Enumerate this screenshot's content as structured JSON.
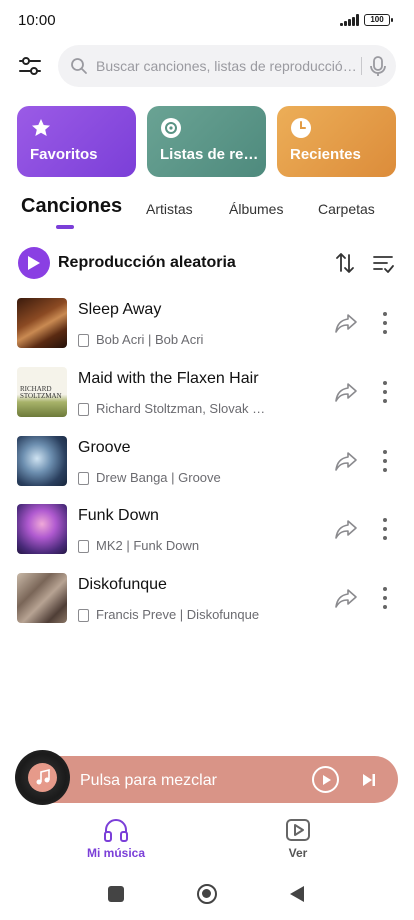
{
  "status": {
    "time": "10:00",
    "battery": "100"
  },
  "search": {
    "placeholder": "Buscar canciones, listas de reproducción, artistas"
  },
  "cards": [
    {
      "label": "Favoritos",
      "icon": "star-icon"
    },
    {
      "label": "Listas de reproducción",
      "icon": "playlist-disc-icon"
    },
    {
      "label": "Recientes",
      "icon": "clock-icon"
    }
  ],
  "tabs": [
    "Canciones",
    "Artistas",
    "Álbumes",
    "Carpetas"
  ],
  "shuffle": {
    "label": "Reproducción aleatoria"
  },
  "songs": [
    {
      "title": "Sleep Away",
      "subtitle": "Bob Acri | Bob Acri"
    },
    {
      "title": "Maid with the Flaxen Hair",
      "subtitle": "Richard Stoltzman, Slovak Radio Symphony Orchestra"
    },
    {
      "title": "Groove",
      "subtitle": "Drew Banga | Groove"
    },
    {
      "title": "Funk Down",
      "subtitle": "MK2 | Funk Down"
    },
    {
      "title": "Diskofunque",
      "subtitle": "Francis Preve | Diskofunque"
    }
  ],
  "player": {
    "label": "Pulsa para mezclar"
  },
  "nav": [
    {
      "label": "Mi música",
      "icon": "headphones-icon"
    },
    {
      "label": "Ver",
      "icon": "video-play-icon"
    }
  ],
  "colors": {
    "accent": "#7b3fd8",
    "player": "#d99487"
  }
}
